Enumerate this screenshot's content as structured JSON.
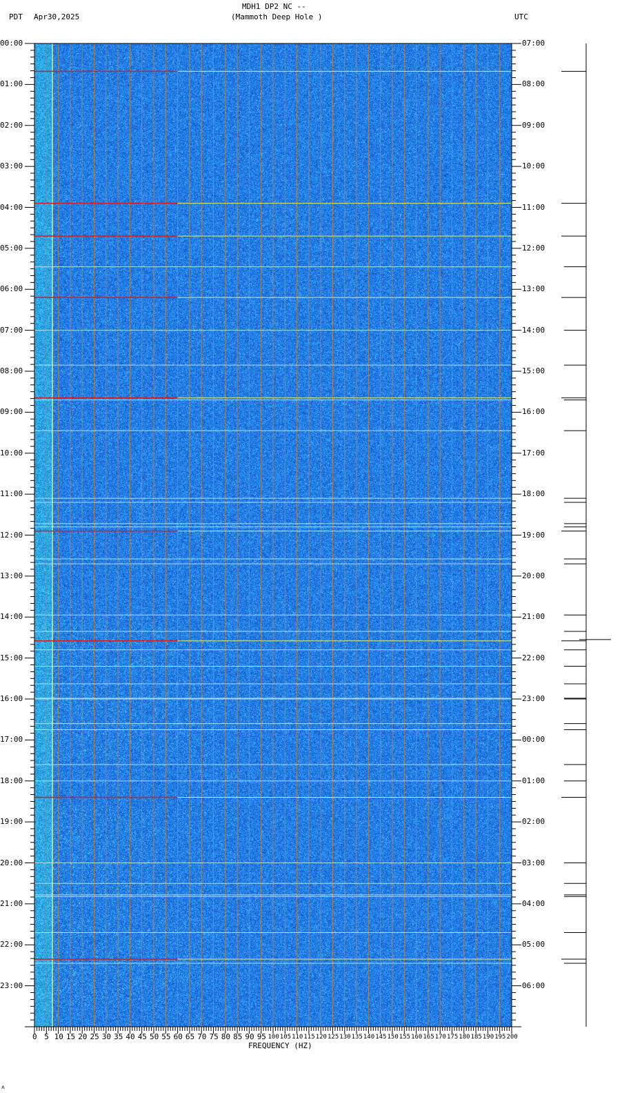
{
  "header": {
    "title_line1": "MDH1 DP2 NC --",
    "title_line2": "(Mammoth Deep Hole )",
    "left_tz": "PDT",
    "date": "Apr30,2025",
    "right_tz": "UTC"
  },
  "footer_mark": "ʌ",
  "chart_data": {
    "type": "heatmap",
    "title": "MDH1 DP2 NC -- (Mammoth Deep Hole )",
    "xlabel": "FREQUENCY (HZ)",
    "ylabel_left": "PDT",
    "ylabel_right": "UTC",
    "xlim": [
      0,
      200
    ],
    "ylim_hours": [
      0,
      24
    ],
    "x_ticks": [
      "0",
      "5",
      "10",
      "15",
      "20",
      "25",
      "30",
      "35",
      "40",
      "45",
      "50",
      "55",
      "60",
      "65",
      "70",
      "75",
      "80",
      "85",
      "90",
      "95",
      "100",
      "105",
      "110",
      "115",
      "120",
      "125",
      "130",
      "135",
      "140",
      "145",
      "150",
      "155",
      "160",
      "165",
      "170",
      "175",
      "180",
      "185",
      "190",
      "195",
      "200"
    ],
    "y_ticks_left": [
      "00:00",
      "01:00",
      "02:00",
      "03:00",
      "04:00",
      "05:00",
      "06:00",
      "07:00",
      "08:00",
      "09:00",
      "10:00",
      "11:00",
      "12:00",
      "13:00",
      "14:00",
      "15:00",
      "16:00",
      "17:00",
      "18:00",
      "19:00",
      "20:00",
      "21:00",
      "22:00",
      "23:00"
    ],
    "y_ticks_right": [
      "07:00",
      "08:00",
      "09:00",
      "10:00",
      "11:00",
      "12:00",
      "13:00",
      "14:00",
      "15:00",
      "16:00",
      "17:00",
      "18:00",
      "19:00",
      "20:00",
      "21:00",
      "22:00",
      "23:00",
      "00:00",
      "01:00",
      "02:00",
      "03:00",
      "04:00",
      "05:00",
      "06:00"
    ],
    "grid": true,
    "grid_interval_hz": 5,
    "persistent_line_hz": 7.5,
    "background_color": "#1e5fe0",
    "grid_color": "#c08040",
    "event_times_pdt_hours": [
      0.68,
      3.9,
      4.7,
      5.45,
      6.2,
      7.0,
      7.85,
      8.65,
      8.7,
      9.45,
      11.1,
      11.2,
      11.72,
      11.8,
      11.9,
      12.58,
      12.7,
      13.95,
      14.35,
      14.58,
      14.8,
      15.2,
      15.63,
      15.98,
      16.0,
      16.6,
      16.75,
      17.6,
      18.0,
      18.4,
      20.0,
      20.5,
      20.78,
      20.82,
      21.7,
      22.35,
      22.45
    ],
    "strong_event_times_pdt_hours": [
      0.68,
      3.9,
      4.7,
      6.2,
      8.65,
      11.9,
      14.58,
      18.4,
      20.8,
      22.35
    ],
    "noise_band_pdt_hours": [
      [
        14.0,
        15.4
      ],
      [
        15.6,
        17.5
      ],
      [
        18.6,
        20.8
      ],
      [
        20.9,
        23.6
      ]
    ]
  }
}
